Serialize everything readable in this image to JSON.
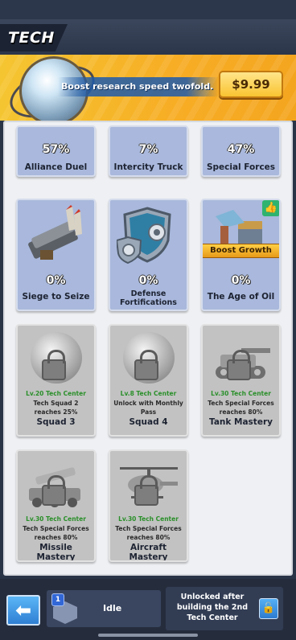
{
  "header": {
    "title": "TECH"
  },
  "banner": {
    "promo_text": "Boost research speed twofold.",
    "price": "$9.99"
  },
  "row1": [
    {
      "percent": "57%",
      "name": "Alliance Duel"
    },
    {
      "percent": "7%",
      "name": "Intercity Truck"
    },
    {
      "percent": "47%",
      "name": "Special Forces"
    }
  ],
  "row2": [
    {
      "percent": "0%",
      "name": "Siege to Seize"
    },
    {
      "percent": "0%",
      "name": "Defense Fortifications"
    },
    {
      "percent": "0%",
      "name": "The Age of Oil",
      "ribbon": "Boost Growth"
    }
  ],
  "row3": [
    {
      "level": "Lv.20 Tech Center",
      "requirement": "Tech Squad 2 reaches 25%",
      "name": "Squad 3"
    },
    {
      "level": "Lv.8 Tech Center",
      "requirement": "Unlock with Monthly Pass",
      "name": "Squad 4"
    },
    {
      "level": "Lv.30 Tech Center",
      "requirement": "Tech Special Forces reaches 80%",
      "name": "Tank Mastery"
    }
  ],
  "row4": [
    {
      "level": "Lv.30 Tech Center",
      "requirement": "Tech Special Forces reaches 80%",
      "name": "Missile Mastery"
    },
    {
      "level": "Lv.30 Tech Center",
      "requirement": "Tech Special Forces reaches 80%",
      "name": "Aircraft Mastery"
    }
  ],
  "bottom": {
    "slot1_badge": "1",
    "slot1_status": "Idle",
    "slot2_text": "Unlocked after building the 2nd Tech Center"
  },
  "colors": {
    "banner": "#f5c531",
    "card_active": "#a9b8dc",
    "card_locked": "#c2c2c2",
    "level_text": "#2a8f2a"
  },
  "icons": [
    "back-arrow-icon",
    "lock-icon",
    "thumbs-up-icon",
    "padlock-icon"
  ]
}
